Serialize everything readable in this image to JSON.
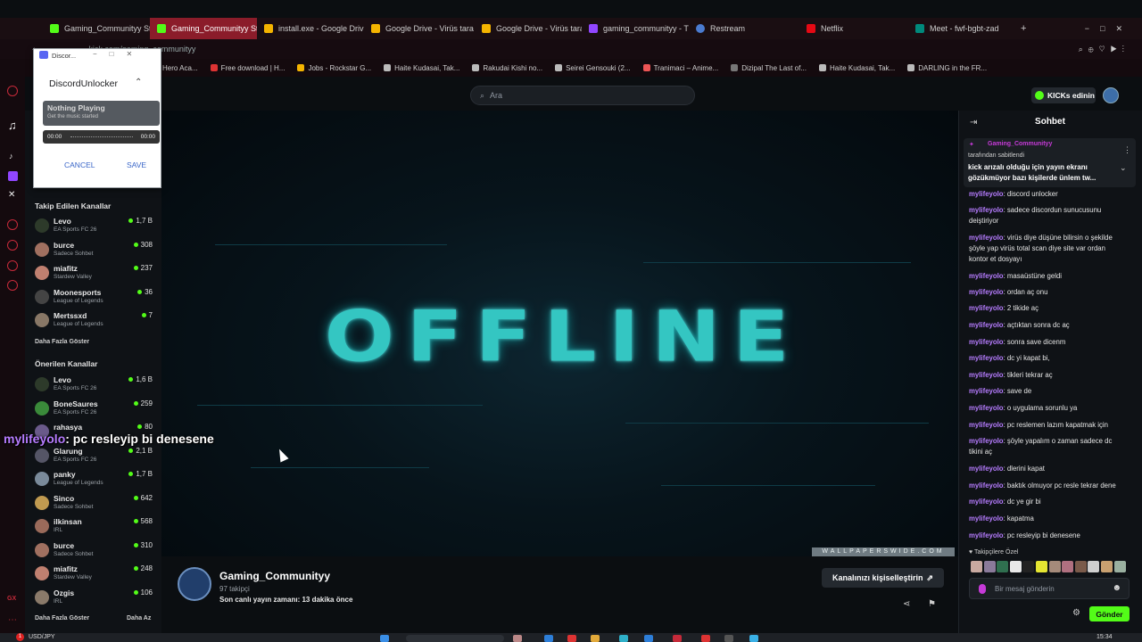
{
  "browser": {
    "tabs": [
      {
        "title": "Gaming_Communityy St",
        "color": "#53fc18",
        "active": false
      },
      {
        "title": "Gaming_Communityy Str",
        "color": "#53fc18",
        "active": true
      },
      {
        "title": "install.exe - Google Driv",
        "color": "#f4b400",
        "active": false
      },
      {
        "title": "Google Drive - Virüs tara",
        "color": "#f4b400",
        "active": false
      },
      {
        "title": "Google Drive - Virüs tara",
        "color": "#f4b400",
        "active": false
      },
      {
        "title": "gaming_communityy - T",
        "color": "#9146ff",
        "active": false
      },
      {
        "title": "Restream",
        "color": "#4a7bd0",
        "active": false
      },
      {
        "title": "Netflix",
        "color": "#e50914",
        "active": false
      },
      {
        "title": "Meet - fwf-bgbt-zad",
        "color": "#00897b",
        "active": false
      }
    ],
    "address": "kick.com/gaming_communityy",
    "bookmarks": [
      {
        "label": "Hero Aca...",
        "color": "#888"
      },
      {
        "label": "Free download | H...",
        "color": "#d33"
      },
      {
        "label": "Jobs - Rockstar G...",
        "color": "#f4b400"
      },
      {
        "label": "Haite Kudasai, Tak...",
        "color": "#bbb"
      },
      {
        "label": "Rakudai Kishi no...",
        "color": "#bbb"
      },
      {
        "label": "Seirei Gensouki (2...",
        "color": "#bbb"
      },
      {
        "label": "Tranimaci – Anime...",
        "color": "#e55"
      },
      {
        "label": "Dizipal The Last of...",
        "color": "#777"
      },
      {
        "label": "Haite Kudasai, Tak...",
        "color": "#bbb"
      },
      {
        "label": "DARLING in the FR...",
        "color": "#bbb"
      }
    ]
  },
  "kick": {
    "search_placeholder": "Ara",
    "kicks_button": "KICKs edinin"
  },
  "sidebar": {
    "followed_title": "Takip Edilen Kanallar",
    "followed": [
      {
        "name": "Levo",
        "game": "EA Sports FC 26",
        "viewers": "1,7 B",
        "color": "#2d3a2a"
      },
      {
        "name": "burce",
        "game": "Sadece Sohbet",
        "viewers": "308",
        "color": "#a07060"
      },
      {
        "name": "miafitz",
        "game": "Stardew Valley",
        "viewers": "237",
        "color": "#c08070"
      },
      {
        "name": "Moonesports",
        "game": "League of Legends",
        "viewers": "36",
        "color": "#444"
      },
      {
        "name": "Mertssxd",
        "game": "League of Legends",
        "viewers": "7",
        "color": "#887766"
      }
    ],
    "followed_more": "Daha Fazla Göster",
    "recommended_title": "Önerilen Kanallar",
    "recommended": [
      {
        "name": "Levo",
        "game": "EA Sports FC 26",
        "viewers": "1,6 B",
        "color": "#2d3a2a"
      },
      {
        "name": "BoneSaures",
        "game": "EA Sports FC 26",
        "viewers": "259",
        "color": "#3a8a3a"
      },
      {
        "name": "rahasya",
        "game": "",
        "viewers": "80",
        "color": "#6a5a8a"
      },
      {
        "name": "Glarung",
        "game": "EA Sports FC 26",
        "viewers": "2,1 B",
        "color": "#556"
      },
      {
        "name": "panky",
        "game": "League of Legends",
        "viewers": "1,7 B",
        "color": "#7a8a9a"
      },
      {
        "name": "Sinco",
        "game": "Sadece Sohbet",
        "viewers": "642",
        "color": "#c09a50"
      },
      {
        "name": "ilkinsan",
        "game": "IRL",
        "viewers": "568",
        "color": "#9a6a5a"
      },
      {
        "name": "burce",
        "game": "Sadece Sohbet",
        "viewers": "310",
        "color": "#a07060"
      },
      {
        "name": "miafitz",
        "game": "Stardew Valley",
        "viewers": "248",
        "color": "#c08070"
      },
      {
        "name": "Ozgis",
        "game": "IRL",
        "viewers": "106",
        "color": "#8a7a6a"
      }
    ],
    "recommended_more": "Daha Fazla Göster",
    "less": "Daha Az"
  },
  "player": {
    "offline_text": "OFFLINE",
    "watermark": "WALLPAPERSWIDE.COM",
    "overlay_user": "mylifeyolo",
    "overlay_text": ": pc resleyip bi denesene"
  },
  "channel": {
    "name": "Gaming_Communityy",
    "followers": "97 takipçi",
    "last_live": "Son canlı yayın zamanı: 13 dakika önce",
    "customize_label": "Kanalınızı kişiselleştirin"
  },
  "chat": {
    "title": "Sohbet",
    "pinned_user": "Gaming_Communityy",
    "pinned_by": "tarafından sabitlendi",
    "pinned_text": "kick arızalı olduğu için yayın ekranı gözükmüyor bazı kişilerde ünlem tw...",
    "messages": [
      {
        "user": "mylifeyolo",
        "text": "discord unlocker"
      },
      {
        "user": "mylifeyolo",
        "text": "sadece discordun sunucusunu deiştiriyor"
      },
      {
        "user": "mylifeyolo",
        "text": "virüs diye düşüne bilirsin o şekilde şöyle yap virüs total scan diye site var ordan kontor et dosyayı"
      },
      {
        "user": "mylifeyolo",
        "text": "masaüstüne geldi"
      },
      {
        "user": "mylifeyolo",
        "text": "ordan aç onu"
      },
      {
        "user": "mylifeyolo",
        "text": "2 tikide aç"
      },
      {
        "user": "mylifeyolo",
        "text": "açtıktan sonra dc aç"
      },
      {
        "user": "mylifeyolo",
        "text": "sonra save dicenm"
      },
      {
        "user": "mylifeyolo",
        "text": "dc yi kapat bi,"
      },
      {
        "user": "mylifeyolo",
        "text": "tikleri tekrar aç"
      },
      {
        "user": "mylifeyolo",
        "text": "save de"
      },
      {
        "user": "mylifeyolo",
        "text": "o uygulama sorunlu ya"
      },
      {
        "user": "mylifeyolo",
        "text": "pc reslemen lazım kapatmak için"
      },
      {
        "user": "mylifeyolo",
        "text": "şöyle yapalım o zaman sadece dc tikini aç"
      },
      {
        "user": "mylifeyolo",
        "text": "dlerini kapat"
      },
      {
        "user": "mylifeyolo",
        "text": "baktık olmuyor pc resle tekrar dene"
      },
      {
        "user": "mylifeyolo",
        "text": "dc ye gir bi"
      },
      {
        "user": "mylifeyolo",
        "text": "kapatma"
      },
      {
        "user": "mylifeyolo",
        "text": "pc resleyip bi denesene"
      }
    ],
    "sub_only": "Takipçilere Özel",
    "input_placeholder": "Bir mesaj gönderin",
    "send_label": "Gönder"
  },
  "popup": {
    "window_title": "Discor...",
    "app_name": "DiscordUnlocker",
    "now_playing_title": "Nothing Playing",
    "now_playing_sub": "Get the music started",
    "time_start": "00:00",
    "time_end": "00:00",
    "cancel_label": "CANCEL",
    "save_label": "SAVE"
  },
  "taskbar": {
    "ticker": "USD/JPY",
    "time": "15:34",
    "notification_count": "1"
  }
}
